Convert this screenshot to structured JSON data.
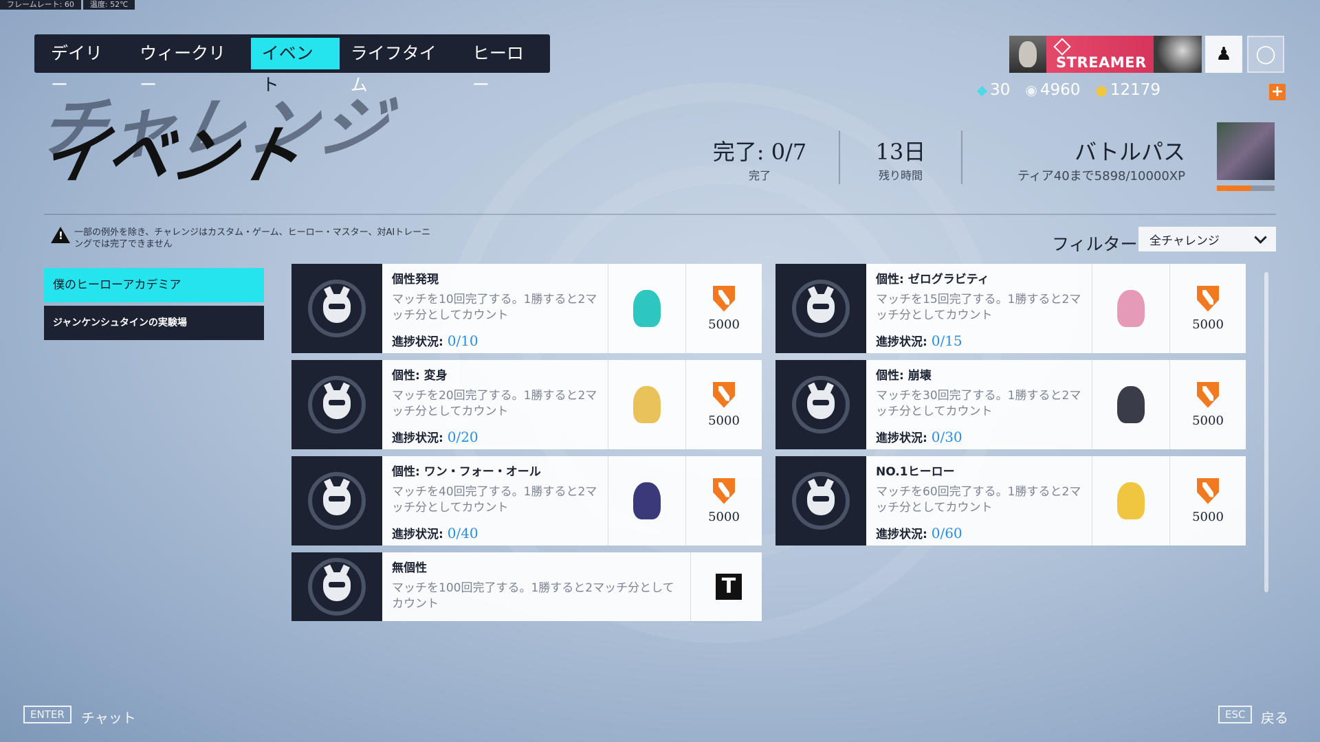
{
  "overlay": {
    "fps": "フレームレート:  60",
    "temp": "温度:  52℃"
  },
  "tabs": [
    {
      "label": "デイリー",
      "active": false
    },
    {
      "label": "ウィークリー",
      "active": false
    },
    {
      "label": "イベント",
      "active": true
    },
    {
      "label": "ライフタイム",
      "active": false
    },
    {
      "label": "ヒーロー",
      "active": false
    }
  ],
  "profile": {
    "badge": "STREAMER"
  },
  "currency": {
    "gems": "30",
    "silver": "4960",
    "gold": "12179",
    "add": "+"
  },
  "title": {
    "main": "イベント",
    "ghost": "チャレンジ"
  },
  "stats": {
    "complete_value": "完了: 0/7",
    "complete_label": "完了",
    "time_value": "13日",
    "time_label": "残り時間"
  },
  "battlepass": {
    "title": "バトルパス",
    "subtitle": "ティア40まで5898/10000XP",
    "progress": 0.59
  },
  "notice": "一部の例外を除き、チャレンジはカスタム・ゲーム、ヒーロー・マスター、対AIトレーニングでは完了できません",
  "filter": {
    "label": "フィルター",
    "value": "全チャレンジ"
  },
  "sidebar": [
    {
      "label": "僕のヒーローアカデミア",
      "active": true
    },
    {
      "label": "ジャンケンシュタインの実験場",
      "active": false
    }
  ],
  "progress_label": "進捗状況:",
  "challenges": [
    {
      "name": "個性発現",
      "desc": "マッチを10回完了する。1勝すると2マッチ分としてカウント",
      "progress": "0/10",
      "reward": "5000",
      "hero_color": "#2ec7c0"
    },
    {
      "name": "個性: ゼログラビティ",
      "desc": "マッチを15回完了する。1勝すると2マッチ分としてカウント",
      "progress": "0/15",
      "reward": "5000",
      "hero_color": "#e59ab8"
    },
    {
      "name": "個性: 変身",
      "desc": "マッチを20回完了する。1勝すると2マッチ分としてカウント",
      "progress": "0/20",
      "reward": "5000",
      "hero_color": "#e9c25a"
    },
    {
      "name": "個性: 崩壊",
      "desc": "マッチを30回完了する。1勝すると2マッチ分としてカウント",
      "progress": "0/30",
      "reward": "5000",
      "hero_color": "#3a3c4a"
    },
    {
      "name": "個性: ワン・フォー・オール",
      "desc": "マッチを40回完了する。1勝すると2マッチ分としてカウント",
      "progress": "0/40",
      "reward": "5000",
      "hero_color": "#3a3a7a"
    },
    {
      "name": "NO.1ヒーロー",
      "desc": "マッチを60回完了する。1勝すると2マッチ分としてカウント",
      "progress": "0/60",
      "reward": "5000",
      "hero_color": "#f0c640"
    },
    {
      "name": "無個性",
      "desc": "マッチを100回完了する。1勝すると2マッチ分としてカウント",
      "reward_badge": "T"
    }
  ],
  "footer": {
    "enter_key": "ENTER",
    "enter_label": "チャット",
    "esc_key": "ESC",
    "esc_label": "戻る"
  },
  "colors": {
    "accent": "#26e4ee",
    "dark": "#1c2232",
    "reward": "#f2791f",
    "progress": "#2a8de0",
    "streamer": "#e9506e"
  }
}
